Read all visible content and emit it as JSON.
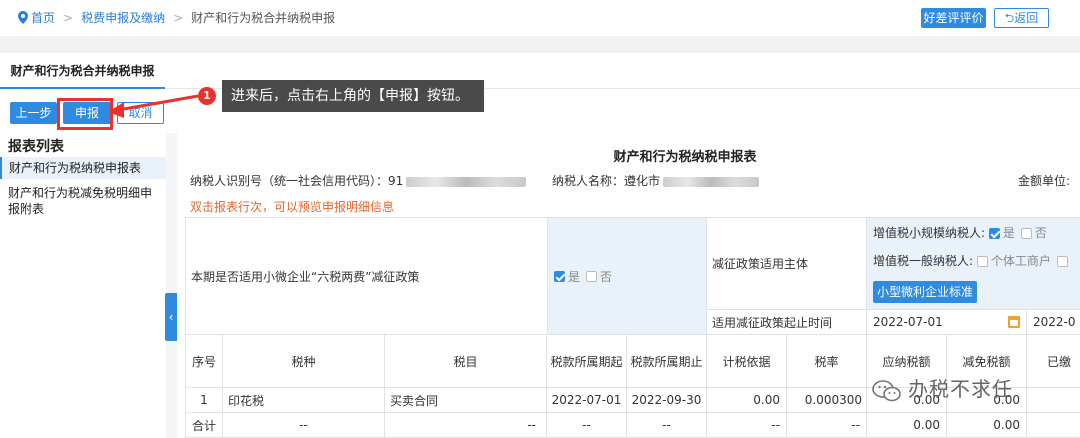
{
  "breadcrumb": {
    "home": "首页",
    "level2": "税费申报及缴纳",
    "current": "财产和行为税合并纳税申报"
  },
  "header": {
    "evaluate": "好差评评价",
    "back": "返回"
  },
  "tab": {
    "active": "财产和行为税合并纳税申报"
  },
  "toolbar": {
    "prev": "上一步",
    "submit": "申报",
    "cancel": "取消"
  },
  "callout": {
    "step": "1",
    "text": "进来后，点击右上角的【申报】按钮。"
  },
  "sidebar": {
    "title": "报表列表",
    "items": [
      "财产和行为税纳税申报表",
      "财产和行为税减免税明细申报附表"
    ]
  },
  "form": {
    "title": "财产和行为税纳税申报表",
    "taxpayer_id_label": "纳税人识别号（统一社会信用代码）：",
    "taxpayer_id_prefix": "91",
    "taxpayer_name_label": "纳税人名称：",
    "taxpayer_name_prefix": "遵化市",
    "amount_unit_label": "金额单位:",
    "hint": "双击报表行次，可以预览申报明细信息"
  },
  "policy": {
    "question": "本期是否适用小微企业“六税两费”减征政策",
    "yes": "是",
    "no": "否",
    "subject_label": "减征政策适用主体",
    "vat_small_label": "增值税小规模纳税人:",
    "vat_general_label": "增值税一般纳税人:",
    "individual_label": "个体工商户",
    "standard_button": "小型微利企业标准",
    "start_label": "适用减征政策起止时间",
    "start_date": "2022-07-01",
    "end_date_partial": "2022-0"
  },
  "table": {
    "headers": [
      "序号",
      "税种",
      "税目",
      "税款所属期起",
      "税款所属期止",
      "计税依据",
      "税率",
      "应纳税额",
      "减免税额",
      "已缴"
    ],
    "rows": [
      [
        "1",
        "印花税",
        "买卖合同",
        "2022-07-01",
        "2022-09-30",
        "0.00",
        "0.000300",
        "0.00",
        "0.00",
        ""
      ]
    ],
    "total": [
      "合计",
      "--",
      "--",
      "--",
      "--",
      "--",
      "--",
      "0.00",
      "0.00",
      ""
    ]
  },
  "watermark": {
    "text": "办税不求任"
  }
}
